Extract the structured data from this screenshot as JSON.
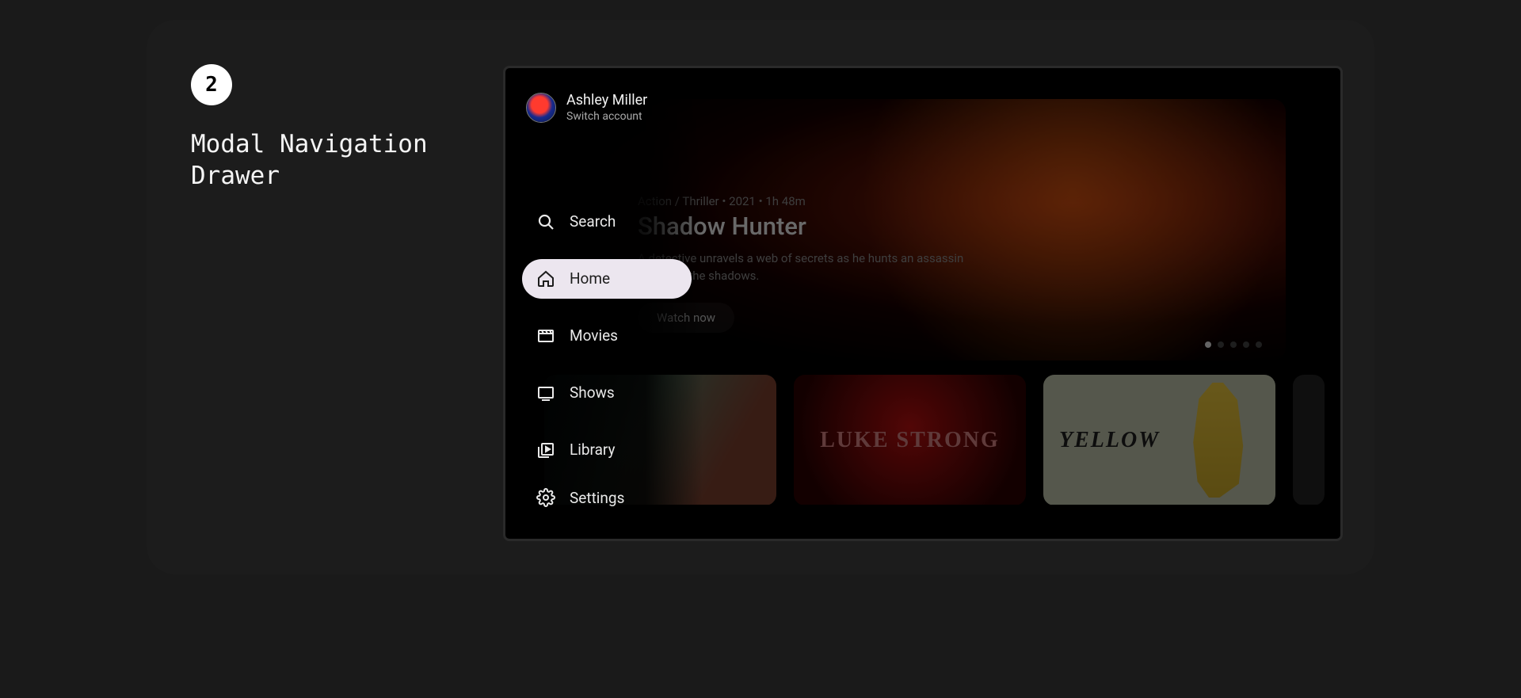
{
  "annotation": {
    "badge": "2",
    "title_line1": "Modal Navigation",
    "title_line2": "Drawer"
  },
  "user": {
    "name": "Ashley Miller",
    "subtitle": "Switch account"
  },
  "nav": {
    "search": "Search",
    "home": "Home",
    "movies": "Movies",
    "shows": "Shows",
    "library": "Library",
    "settings": "Settings"
  },
  "hero": {
    "meta": "Action / Thriller • 2021 • 1h 48m",
    "title": "Shadow Hunter",
    "description": "A detective unravels a web of secrets as he hunts an assassin lurking in the shadows.",
    "cta": "Watch now",
    "dots_total": 5,
    "dots_active_index": 0
  },
  "row": {
    "card2_title": "LUKE STRONG",
    "card3_title": "YELLOW"
  }
}
